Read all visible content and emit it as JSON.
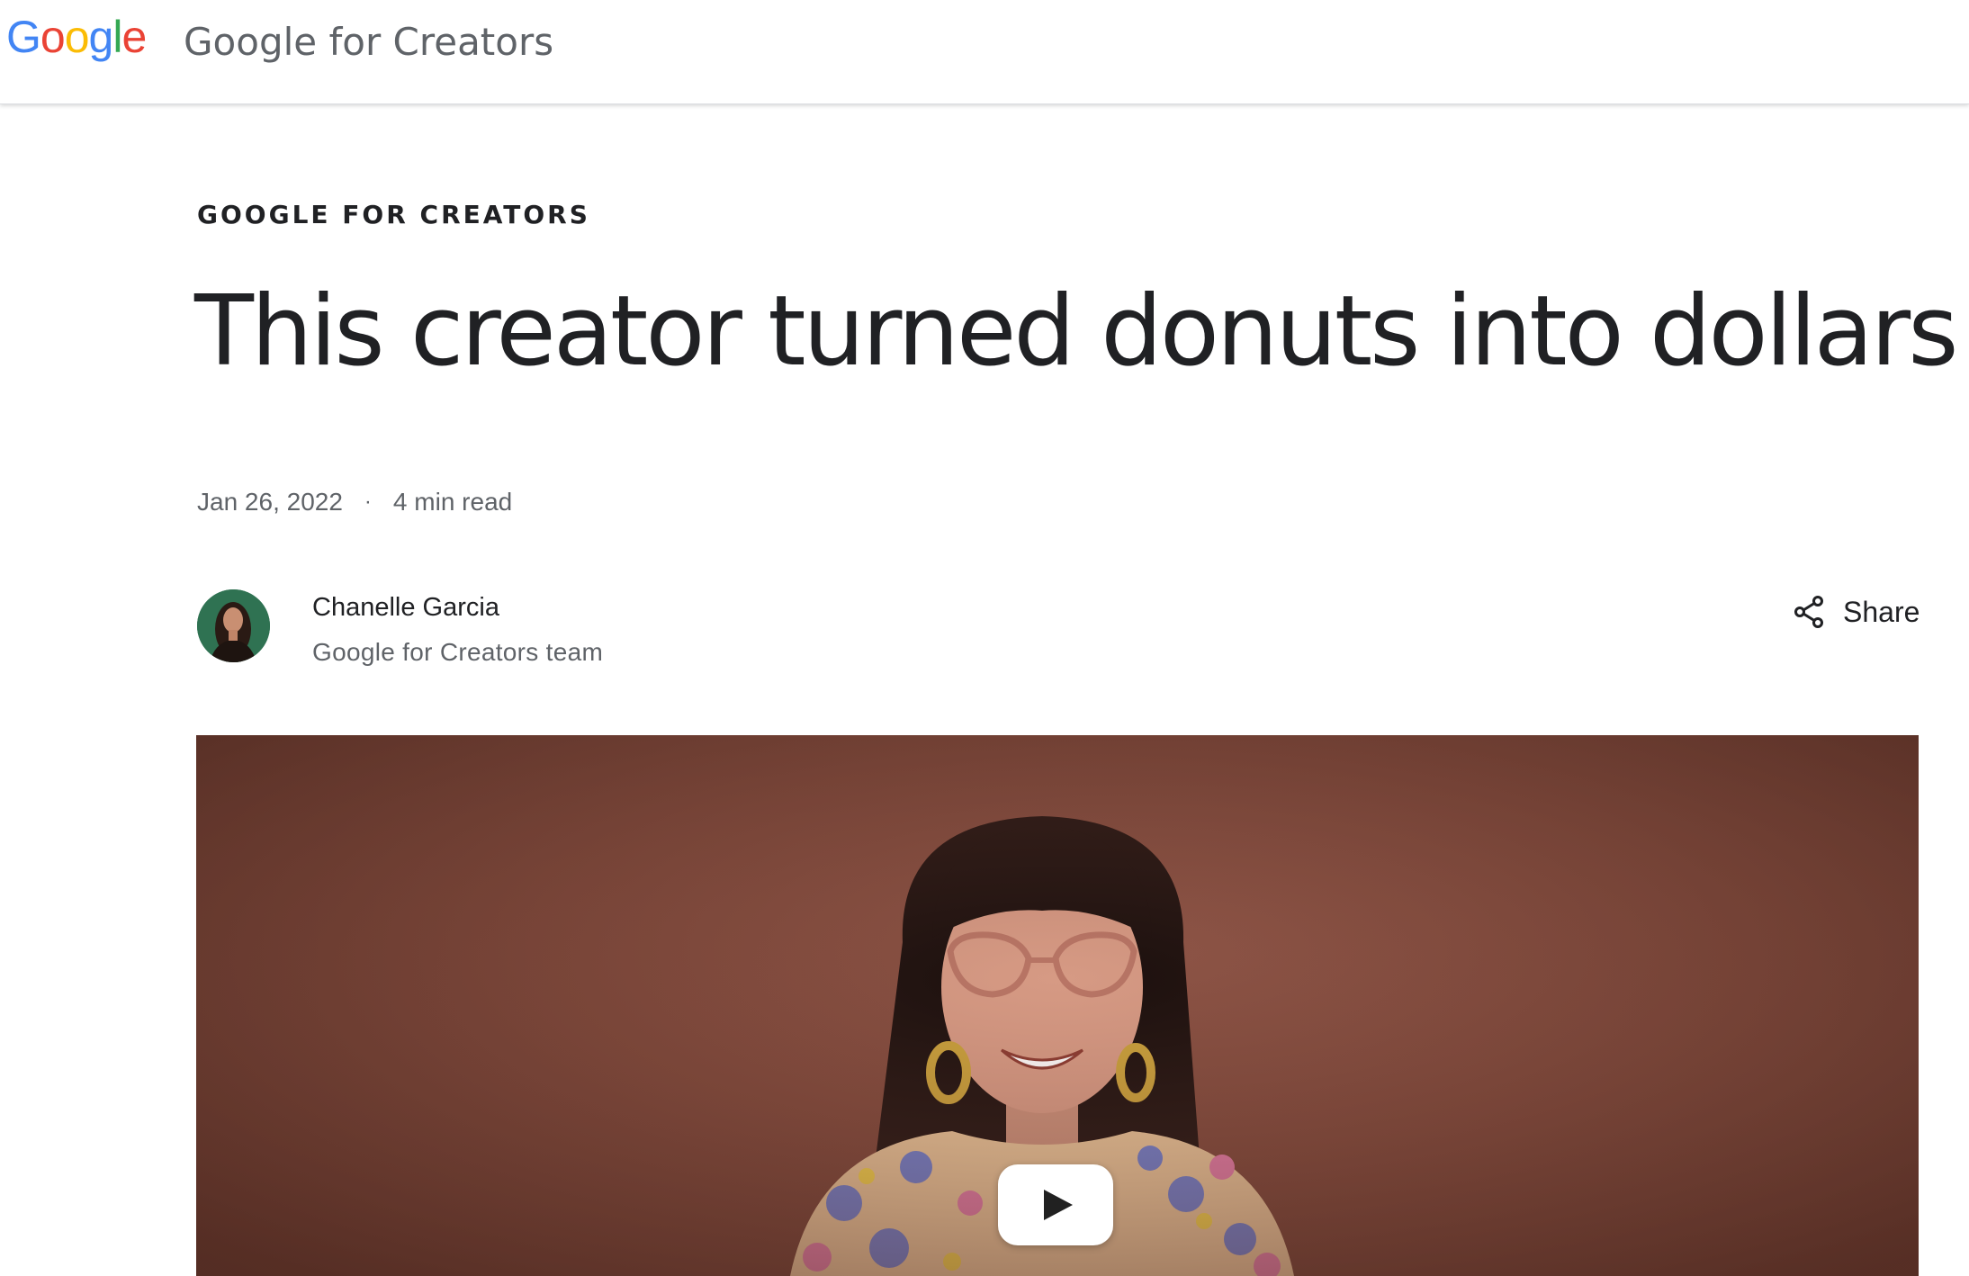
{
  "header": {
    "logo_text": "Google",
    "site_title": "Google for Creators"
  },
  "article": {
    "eyebrow": "GOOGLE FOR CREATORS",
    "headline": "This creator turned donuts into dollars",
    "date": "Jan 26, 2022",
    "separator": "·",
    "read_time": "4 min read"
  },
  "author": {
    "name": "Chanelle Garcia",
    "team": "Google for Creators team"
  },
  "share": {
    "label": "Share",
    "icon": "share-icon"
  },
  "video": {
    "play_icon": "play-icon"
  },
  "colors": {
    "google_blue": "#4285f4",
    "google_red": "#ea4335",
    "google_yellow": "#fbbc05",
    "google_green": "#34a853",
    "text_primary": "#202124",
    "text_secondary": "#5f6368"
  }
}
